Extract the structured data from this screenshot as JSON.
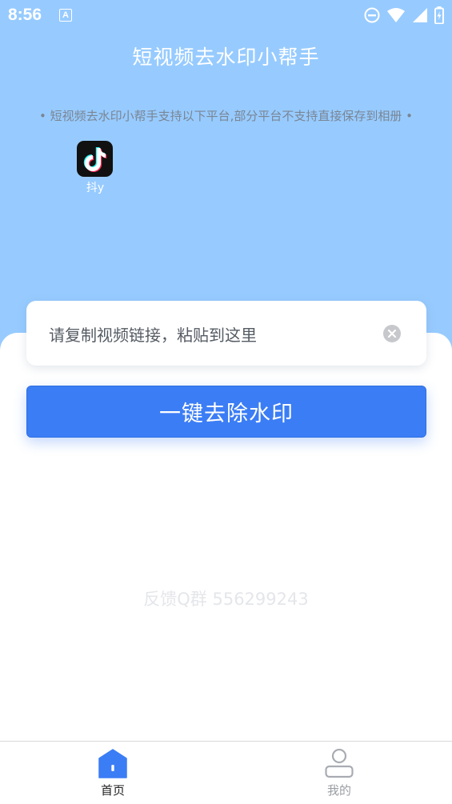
{
  "status_bar": {
    "time": "8:56",
    "notification_badge": "A",
    "icons": [
      "dnd-icon",
      "wifi-icon",
      "signal-icon",
      "battery-icon"
    ]
  },
  "header": {
    "title": "短视频去水印小帮手",
    "platform_note": "• 短视频去水印小帮手支持以下平台,部分平台不支持直接保存到相册 •"
  },
  "platforms": [
    {
      "name": "抖y",
      "icon": "tiktok-icon"
    }
  ],
  "input": {
    "placeholder": "请复制视频链接，粘贴到这里",
    "clear_icon": "clear-icon"
  },
  "action_button": {
    "label": "一键去除水印"
  },
  "feedback": {
    "text": "反馈Q群 556299243"
  },
  "bottom_nav": {
    "items": [
      {
        "label": "首页",
        "icon": "home-icon",
        "active": true
      },
      {
        "label": "我的",
        "icon": "user-icon",
        "active": false
      }
    ]
  },
  "colors": {
    "header_bg": "#97cbff",
    "accent": "#3b7df5",
    "inactive": "#9a9ea4"
  }
}
